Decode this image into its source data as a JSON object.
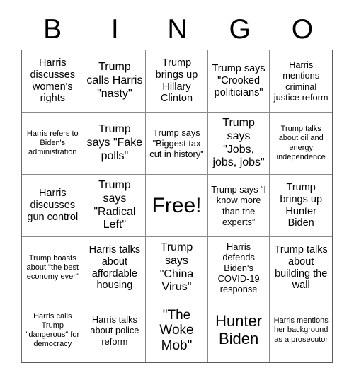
{
  "card": {
    "title": "Bingo Card",
    "header_letters": [
      "B",
      "I",
      "N",
      "G",
      "O"
    ],
    "columns": 5,
    "rows": 5,
    "free_space_index": 12,
    "colors": {
      "background": "#ffffff",
      "text": "#000000",
      "grid_line": "#8a8a8a",
      "outer_border": "#5a5a5a"
    },
    "cells": [
      {
        "text": "Harris discusses women's rights",
        "size": "sm",
        "free": false
      },
      {
        "text": "Trump calls Harris \"nasty\"",
        "size": "base",
        "free": false
      },
      {
        "text": "Trump brings up Hillary Clinton",
        "size": "sm",
        "free": false
      },
      {
        "text": "Trump says \"Crooked politicians\"",
        "size": "sm",
        "free": false
      },
      {
        "text": "Harris mentions criminal justice reform",
        "size": "xs",
        "free": false
      },
      {
        "text": "Harris refers to Biden's administration",
        "size": "xxs",
        "free": false
      },
      {
        "text": "Trump says \"Fake polls\"",
        "size": "base",
        "free": false
      },
      {
        "text": "Trump says \"Biggest tax cut in history\"",
        "size": "xs",
        "free": false
      },
      {
        "text": "Trump says \"Jobs, jobs, jobs\"",
        "size": "base",
        "free": false
      },
      {
        "text": "Trump talks about oil and energy independence",
        "size": "xxs",
        "free": false
      },
      {
        "text": "Harris discusses gun control",
        "size": "sm",
        "free": false
      },
      {
        "text": "Trump says \"Radical Left\"",
        "size": "base",
        "free": false
      },
      {
        "text": "Free!",
        "size": "xl",
        "free": true
      },
      {
        "text": "Trump says “I know more than the experts”",
        "size": "xs",
        "free": false
      },
      {
        "text": "Trump brings up Hunter Biden",
        "size": "sm",
        "free": false
      },
      {
        "text": "Trump boasts about \"the best economy ever\"",
        "size": "xxs",
        "free": false
      },
      {
        "text": "Harris talks about affordable housing",
        "size": "sm",
        "free": false
      },
      {
        "text": "Trump says \"China Virus\"",
        "size": "base",
        "free": false
      },
      {
        "text": "Harris defends Biden's COVID-19 response",
        "size": "xs",
        "free": false
      },
      {
        "text": "Trump talks about building the wall",
        "size": "sm",
        "free": false
      },
      {
        "text": "Harris calls Trump \"dangerous\" for democracy",
        "size": "xxs",
        "free": false
      },
      {
        "text": "Harris talks about police reform",
        "size": "xs",
        "free": false
      },
      {
        "text": "\"The Woke Mob\"",
        "size": "md",
        "free": false
      },
      {
        "text": "Hunter Biden",
        "size": "lg",
        "free": false
      },
      {
        "text": "Harris mentions her background as a prosecutor",
        "size": "xxs",
        "free": false
      }
    ]
  }
}
